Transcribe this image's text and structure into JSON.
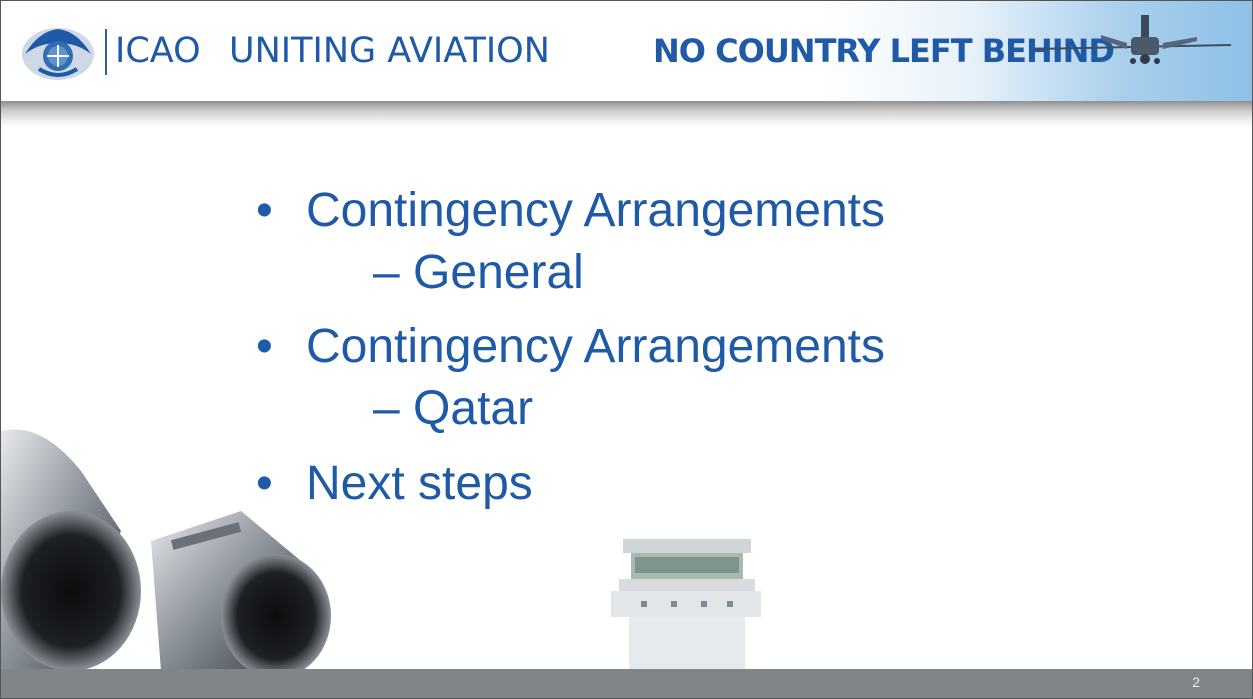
{
  "header": {
    "org_name": "ICAO",
    "tagline": "UNITING AVIATION",
    "slogan": "NO COUNTRY LEFT BEHIND",
    "emblem_icon": "icao-emblem-icon",
    "plane_icon": "airplane-icon"
  },
  "bullets": [
    {
      "text": "Contingency Arrangements",
      "sub": "– General"
    },
    {
      "text": "Contingency Arrangements",
      "sub": "– Qatar"
    },
    {
      "text": "Next steps",
      "sub": ""
    }
  ],
  "bullet_symbol": "•",
  "footer": {
    "page_number": "2"
  },
  "colors": {
    "text_blue": "#1f5aa6",
    "footer_gray": "#808589",
    "sky_blue": "#8ec0e7"
  }
}
